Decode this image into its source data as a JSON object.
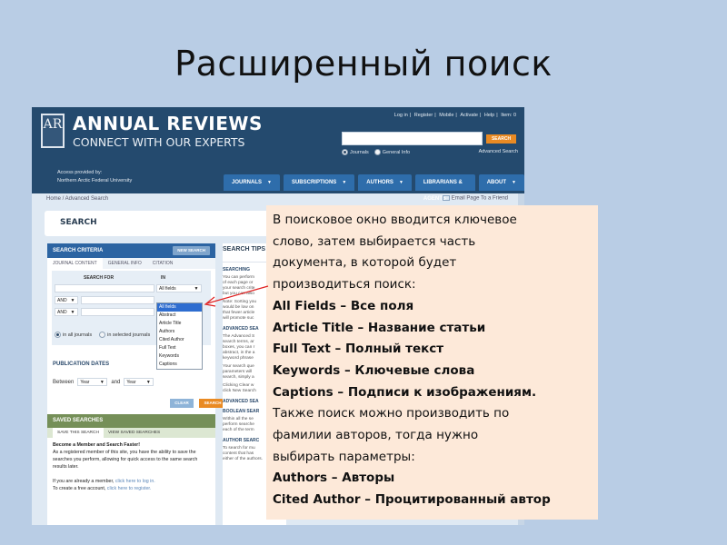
{
  "slide": {
    "title": "Расширенный поиск",
    "background": "#b9cde5"
  },
  "site": {
    "logo_text": "AR",
    "brand": "ANNUAL REVIEWS",
    "tagline": "CONNECT WITH OUR EXPERTS",
    "access_line1": "Access provided by:",
    "access_line2": "Northern Arctic Federal University",
    "top_links": [
      "Log in",
      "Register",
      "Mobile",
      "Activate",
      "Help",
      "Item: 0"
    ],
    "search_button": "SEARCH",
    "search_value": "",
    "scope_options": [
      {
        "label": "Journals",
        "selected": true
      },
      {
        "label": "General Info",
        "selected": false
      }
    ],
    "advanced_search_link": "Advanced Search",
    "nav": [
      "JOURNALS",
      "SUBSCRIPTIONS",
      "AUTHORS",
      "LIBRARIANS & AGENTS",
      "ABOUT"
    ],
    "breadcrumb": "Home / Advanced Search",
    "email_link": "Email Page To a Friend",
    "page_heading": "SEARCH",
    "colors": {
      "header": "#244a6e",
      "nav": "#2e6dab",
      "accent": "#e98a23",
      "saved": "#758f58"
    }
  },
  "criteria": {
    "title": "SEARCH CRITERIA",
    "new_search": "NEW SEARCH",
    "tabs": [
      "JOURNAL CONTENT",
      "GENERAL INFO",
      "CITATION"
    ],
    "search_for_label": "SEARCH FOR",
    "in_label": "IN",
    "rows": [
      {
        "operator": "",
        "value": "",
        "field": "All fields"
      },
      {
        "operator": "AND",
        "value": ""
      },
      {
        "operator": "AND",
        "value": ""
      }
    ],
    "scope": [
      {
        "label": "in all journals",
        "selected": true
      },
      {
        "label": "in selected journals",
        "selected": false
      }
    ],
    "field_options": [
      "All fields",
      "Abstract",
      "Article Title",
      "Authors",
      "Cited Author",
      "Full Text",
      "Keywords",
      "Captions"
    ],
    "highlighted_option": "All fields",
    "publication_dates": "PUBLICATION DATES",
    "between": "Between",
    "and": "and",
    "from_year": "Year",
    "to_year": "Year",
    "clear": "CLEAR",
    "search": "SEARCH"
  },
  "saved": {
    "title": "SAVED SEARCHES",
    "tabs": [
      "SAVE THIS SEARCH",
      "VIEW SAVED SEARCHES"
    ],
    "heading": "Become a Member and Search Faster!",
    "body": "As a registered member of this site, you have the ability to save the searches you perform, allowing for quick access to the same search results later.",
    "member_text": "If you are already a member,",
    "member_link": "click here to log in.",
    "create_text": "To create a free account,",
    "create_link": "click here to register."
  },
  "tips": {
    "title": "SEARCH TIPS",
    "sections": [
      {
        "heading": "SEARCHING",
        "lines": [
          "You can perform",
          "of each page or",
          "your search crite",
          "but you can also"
        ]
      },
      {
        "heading": "",
        "lines": [
          "Note: Sorting you",
          "would be low on",
          "that fewer article",
          "will promote suc"
        ]
      },
      {
        "heading": "ADVANCED SEA",
        "lines": [
          "The Advanced S",
          "search terms, ar",
          "boxes, you can r",
          "abstract, in the a",
          "keyword phrase"
        ]
      },
      {
        "heading": "",
        "lines": [
          "Your search que",
          "parameters will",
          "search, simply a"
        ]
      },
      {
        "heading": "",
        "lines": [
          "Clicking Clear w",
          "click New Search"
        ]
      },
      {
        "heading": "ADVANCED SEA",
        "lines": []
      },
      {
        "heading": "BOOLEAN SEAR",
        "lines": [
          "Within all the se",
          "perform searche",
          "each of the term"
        ]
      },
      {
        "heading": "AUTHOR SEARC",
        "lines": [
          "To search for mu",
          "content that has",
          "either of the authors."
        ]
      }
    ]
  },
  "note": {
    "intro": [
      "В поисковое окно вводится ключевое",
      "слово, затем выбирается часть",
      "документа, в которой будет",
      "производиться поиск:"
    ],
    "field_map": [
      "All Fields – Все поля",
      "Article Title – Название статьи",
      "Full Text – Полный текст",
      "Keywords – Ключевые слова",
      "Captions – Подписи к изображениям."
    ],
    "middle": [
      "Также поиск можно производить по",
      "фамилии  авторов, тогда нужно",
      "выбирать параметры:"
    ],
    "author_map": [
      "Authors – Авторы",
      "Cited Author – Процитированный автор"
    ],
    "background": "#fde9d9"
  }
}
